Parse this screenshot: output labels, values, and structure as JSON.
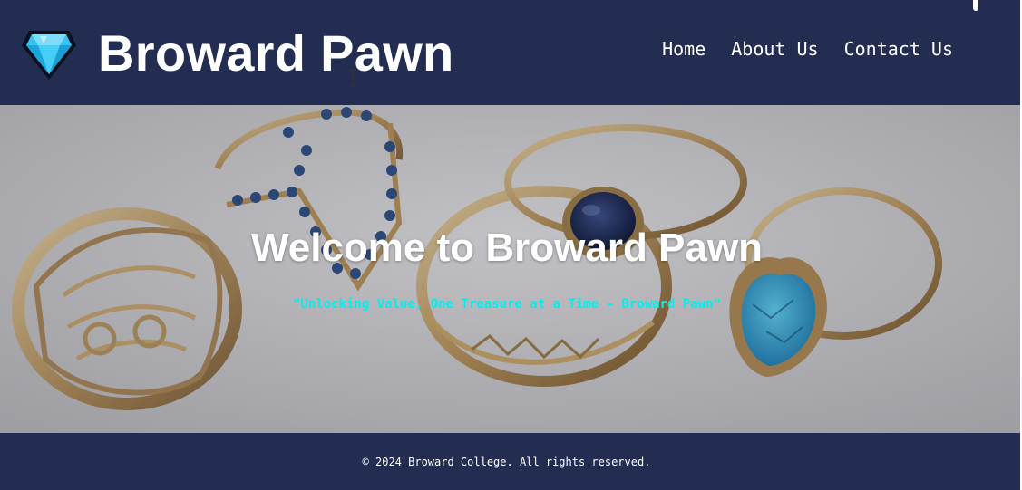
{
  "header": {
    "brand": "Broward Pawn",
    "logo_icon": "diamond-icon",
    "nav": [
      {
        "label": "Home"
      },
      {
        "label": "About Us"
      },
      {
        "label": "Contact Us"
      }
    ]
  },
  "hero": {
    "title": "Welcome to Broward Pawn",
    "tagline": "\"Unlocking Value, One Treasure at a Time - Broward Pawn\"",
    "background_image": "rings-photo"
  },
  "footer": {
    "text": "© 2024 Broward College. All rights reserved."
  },
  "colors": {
    "header_bg": "#232d52",
    "footer_bg": "#232d52",
    "tagline": "#00f0f0",
    "text": "#ffffff",
    "diamond": "#3cc8f0"
  }
}
